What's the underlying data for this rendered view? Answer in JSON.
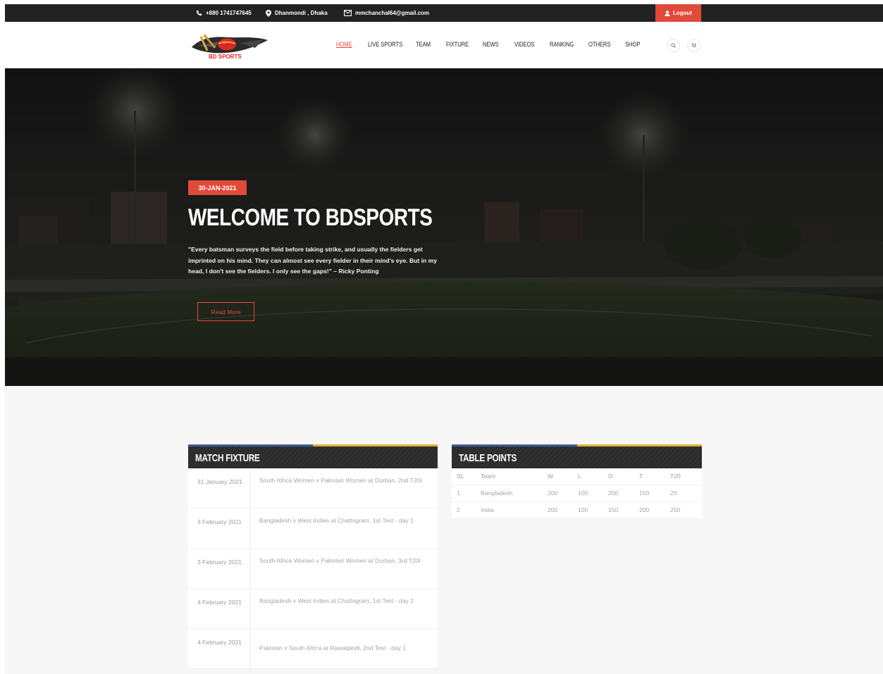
{
  "topbar": {
    "phone": "+880 1741747645",
    "location": "Dhanmondi , Dhaka",
    "email": "mmchanchal64@gmail.com",
    "logout_label": "Logout"
  },
  "header": {
    "logo_text": "BD SPORTS",
    "nav": [
      {
        "label": "HOME",
        "active": true
      },
      {
        "label": "LIVE SPORTS",
        "active": false
      },
      {
        "label": "TEAM",
        "active": false
      },
      {
        "label": "FIXTURE",
        "active": false
      },
      {
        "label": "NEWS",
        "active": false
      },
      {
        "label": "VIDEOS",
        "active": false
      },
      {
        "label": "RANKING",
        "active": false
      },
      {
        "label": "OTHERS",
        "active": false
      },
      {
        "label": "SHOP",
        "active": false
      }
    ],
    "icons": [
      "search-icon",
      "cart-icon"
    ]
  },
  "hero": {
    "date": "30-JAN-2021",
    "title": "WELCOME TO BDSPORTS",
    "quote": "\"Every batsman surveys the field before taking strike, and usually the fielders get imprinted on his mind. They can almost see every fielder in their mind's eye. But in my head, I don't see the fielders. I only see the gaps!\" – Ricky Ponting",
    "button_label": "Read More"
  },
  "fixture": {
    "title": "MATCH FIXTURE",
    "rows": [
      {
        "date": "31 January 2021",
        "match": "South Africa Women v Pakistan Women at Durban, 2nd T20I"
      },
      {
        "date": "3 February 2021",
        "match": "Bangladesh v West Indies at Chattogram, 1st Test - day 1"
      },
      {
        "date": "3 February 2021",
        "match": "South Africa Women v Pakistan Women at Durban, 3rd T20I"
      },
      {
        "date": "4 February 2021",
        "match": "Bangladesh v West Indies at Chattogram, 1st Test - day 2"
      },
      {
        "date": "4 February 2021",
        "match": "Pakistan v South Africa at Rawalpindi, 2nd Test - day 1"
      }
    ]
  },
  "points": {
    "title": "TABLE POINTS",
    "columns": [
      "SL",
      "Team",
      "W",
      "L",
      "O",
      "T",
      "T20"
    ],
    "rows": [
      [
        "1",
        "Bangladesh",
        "200",
        "100",
        "200",
        "150",
        "20"
      ],
      [
        "2",
        "India",
        "200",
        "100",
        "150",
        "200",
        "250"
      ]
    ]
  },
  "colors": {
    "accent": "#e04a3a",
    "topbar": "#222222",
    "stripe_blue": "#3f5e99",
    "stripe_gold": "#e3b030"
  }
}
